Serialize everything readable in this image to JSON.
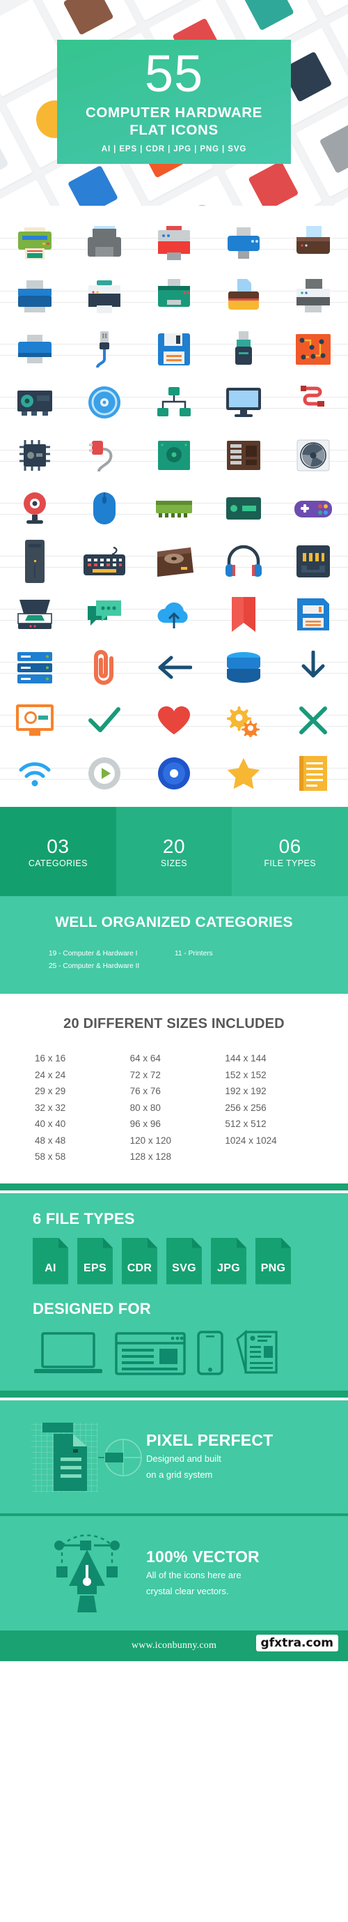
{
  "hero": {
    "count": "55",
    "title_line1": "COMPUTER HARDWARE",
    "title_line2": "FLAT ICONS",
    "file_formats": "AI  |  EPS  | CDR |  JPG  |  PNG  |  SVG",
    "panel_color": "#3fc4a0"
  },
  "icon_grid": {
    "rows": [
      [
        "printer-green",
        "printer-grey",
        "printer-red",
        "printer-blue",
        "printer-brown"
      ],
      [
        "printer-blue-2",
        "printer-navy",
        "printer-teal",
        "printer-yellow",
        "printer-darkgrey"
      ],
      [
        "printer-blue-3",
        "usb-cable",
        "floppy-disk",
        "usb-flash-drive",
        "circuit-board"
      ],
      [
        "graphics-card",
        "cd-disc",
        "network-switch",
        "monitor",
        "cable-red"
      ],
      [
        "processor-chip",
        "power-plug",
        "hard-drive-green",
        "motherboard",
        "cooling-fan"
      ],
      [
        "web-cam",
        "computer-mouse",
        "ram-module",
        "server-box",
        "game-controller"
      ],
      [
        "computer-tower",
        "keyboard",
        "hard-disk-box",
        "headphones",
        "ethernet-port"
      ],
      [
        "scanner",
        "chat-bubbles",
        "cloud-upload",
        "bookmark-ribbon",
        "floppy-save"
      ],
      [
        "server-rack",
        "paper-clip",
        "arrow-left",
        "database-server",
        "download-arrow"
      ],
      [
        "monitor-settings",
        "check-mark",
        "heart",
        "gears",
        "cross-mark"
      ],
      [
        "wifi-signal",
        "play-button",
        "compact-disc",
        "star",
        "document-lines"
      ]
    ]
  },
  "stats": [
    {
      "num": "03",
      "label": "CATEGORIES",
      "color": "#14a06e"
    },
    {
      "num": "20",
      "label": "SIZES",
      "color": "#25b183"
    },
    {
      "num": "06",
      "label": "FILE TYPES",
      "color": "#31bb90"
    }
  ],
  "categories": {
    "heading": "WELL ORGANIZED CATEGORIES",
    "left": [
      "19 - Computer & Hardware I",
      "25 - Computer & Hardware II"
    ],
    "right": [
      "11 - Printers"
    ]
  },
  "sizes": {
    "heading": "20 DIFFERENT SIZES INCLUDED",
    "col1": [
      "16 x 16",
      "24 x 24",
      "29 x 29",
      "32 x 32",
      "40 x 40",
      "48 x 48",
      "58 x 58"
    ],
    "col2": [
      "64 x 64",
      "72 x 72",
      "76 x 76",
      "80 x 80",
      "96 x 96",
      "120 x 120",
      "128 x 128"
    ],
    "col3": [
      "144 x 144",
      "152 x 152",
      "192 x 192",
      "256 x 256",
      "512 x 512",
      "1024 x 1024"
    ]
  },
  "file_types": {
    "heading": "6 FILE TYPES",
    "badges": [
      "AI",
      "EPS",
      "CDR",
      "SVG",
      "JPG",
      "PNG"
    ]
  },
  "designed_for": {
    "heading": "DESIGNED FOR",
    "devices": [
      "laptop-icon",
      "browser-window-icon",
      "smartphone-icon",
      "documents-icon"
    ]
  },
  "features": [
    {
      "art": "pixel-grid-document-icon",
      "title": "PIXEL PERFECT",
      "line1": "Designed and built",
      "line2": "on a grid system"
    },
    {
      "art": "pen-tool-icon",
      "title": "100% VECTOR",
      "line1": "All of the icons here are",
      "line2": "crystal clear vectors."
    }
  ],
  "footer": {
    "url": "www.iconbunny.com",
    "watermark": "gfxtra.com"
  }
}
